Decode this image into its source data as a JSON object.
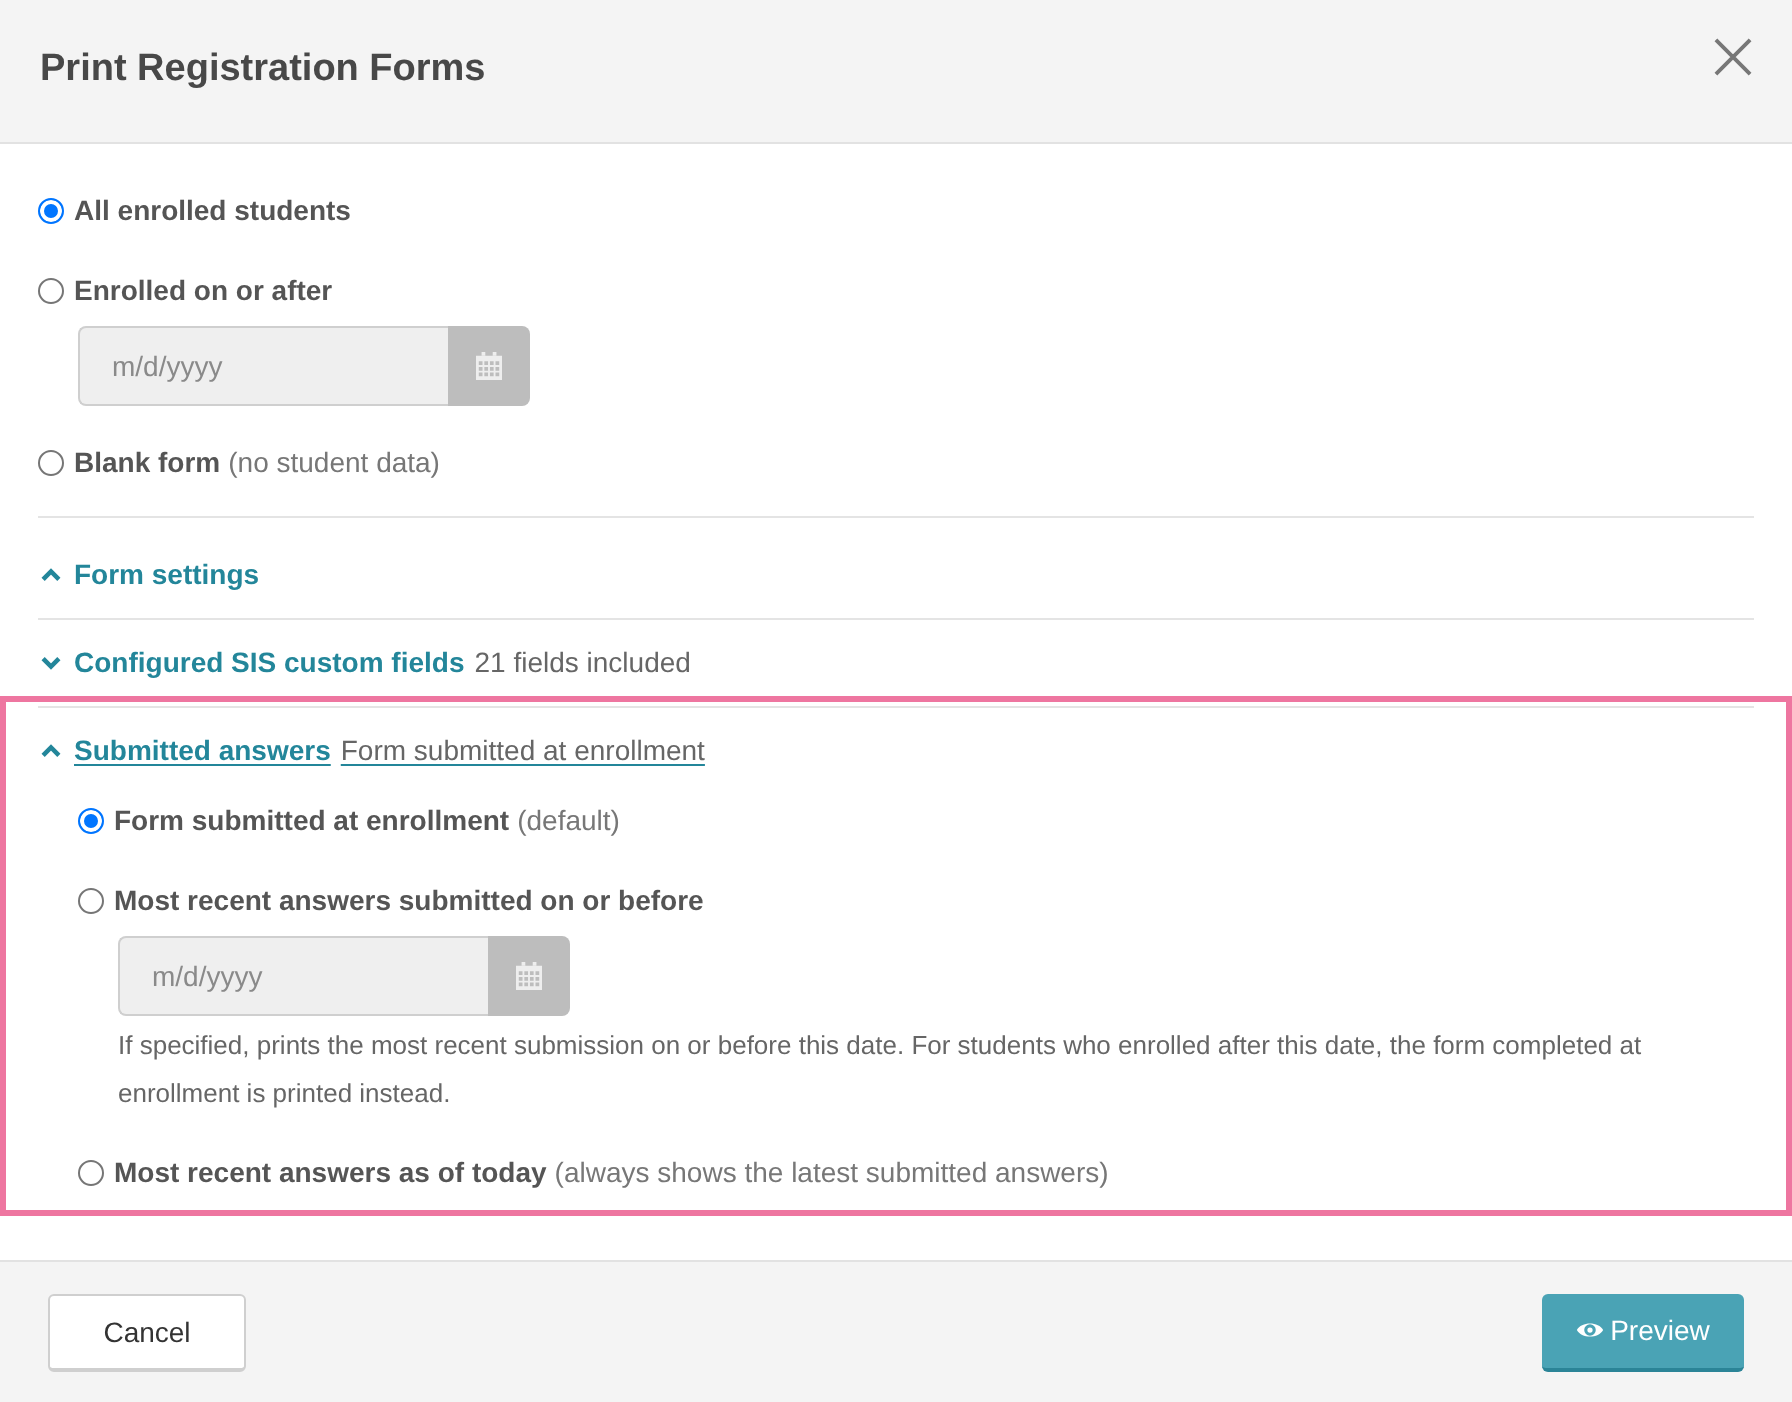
{
  "dialog": {
    "title": "Print Registration Forms"
  },
  "scope_options": [
    {
      "label": "All enrolled students",
      "selected": true
    },
    {
      "label": "Enrolled on or after",
      "selected": false,
      "date_field": {
        "placeholder": "m/d/yyyy"
      }
    },
    {
      "label": "Blank form",
      "note": "(no student data)",
      "selected": false
    }
  ],
  "sections": [
    {
      "title": "Form settings",
      "expanded": true,
      "highlighted": false
    },
    {
      "title": "Configured SIS custom fields",
      "summary": "21 fields included",
      "expanded": false,
      "highlighted": false
    },
    {
      "title": "Submitted answers",
      "summary": "Form submitted at enrollment",
      "expanded": true,
      "highlighted": true,
      "options": [
        {
          "label": "Form submitted at enrollment",
          "note": "(default)",
          "selected": true
        },
        {
          "label": "Most recent answers submitted on or before",
          "selected": false,
          "date_field": {
            "placeholder": "m/d/yyyy"
          },
          "help": "If specified, prints the most recent submission on or before this date. For students who enrolled after this date, the form completed at enrollment is printed instead."
        },
        {
          "label": "Most recent answers as of today",
          "note": "(always shows the latest submitted answers)",
          "selected": false
        }
      ]
    }
  ],
  "buttons": [
    {
      "label": "Cancel",
      "kind": "secondary"
    },
    {
      "label": "Preview",
      "kind": "primary"
    }
  ]
}
